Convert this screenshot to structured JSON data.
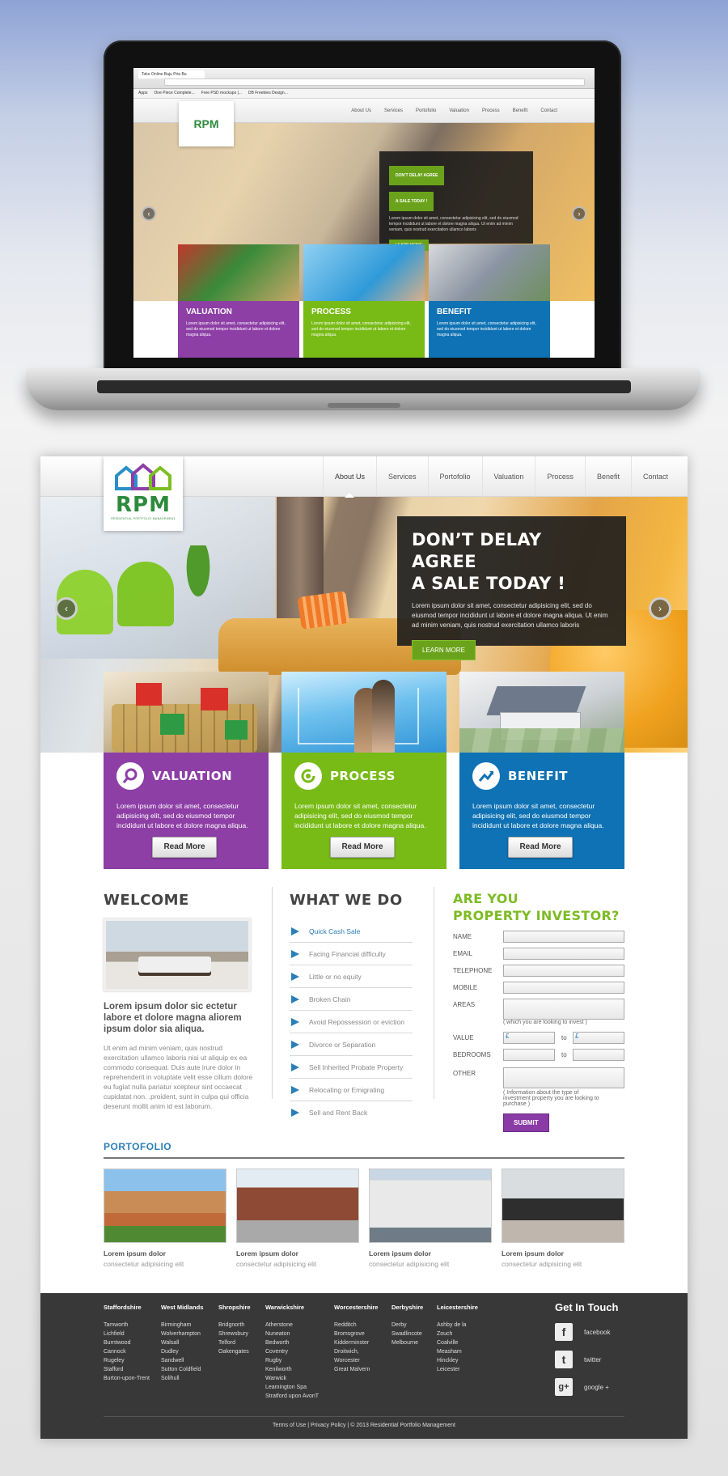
{
  "laptop": {
    "browser_tab": "Toko Online Baju Pria Bu",
    "bookmarks": [
      "Apps",
      "One Piece Complete...",
      "Free PSD mockups |...",
      "DB Freebies Design..."
    ]
  },
  "nav": {
    "links": [
      "About Us",
      "Services",
      "Portofolio",
      "Valuation",
      "Process",
      "Benefit",
      "Contact"
    ],
    "active": "About Us"
  },
  "logo": {
    "text": "RPM",
    "subtitle": "RESIDENTIAL PORTFOLIO MANAGEMENT"
  },
  "hero": {
    "title_line1": "DON’T DELAY AGREE",
    "title_line2": "A SALE TODAY !",
    "text": "Lorem ipsum dolor sit amet, consectetur adipisicing elit, sed do eiusmod tempor incididunt ut labore et dolore magna aliqua. Ut enim ad minim veniam, quis nostrud exercitation ullamco laboris",
    "button": "LEARN MORE",
    "prev_icon": "‹",
    "next_icon": "›"
  },
  "cards": [
    {
      "title": "VALUATION",
      "text": "Lorem ipsum dolor sit amet, consectetur adipisicing elit, sed do eiusmod tempor incididunt ut labore et dolore magna aliqua.",
      "button": "Read More",
      "color": "#8d3fa6"
    },
    {
      "title": "PROCESS",
      "text": "Lorem ipsum dolor sit amet, consectetur adipisicing elit, sed do eiusmod tempor incididunt ut labore et dolore magna aliqua.",
      "button": "Read More",
      "color": "#78bb16"
    },
    {
      "title": "BENEFIT",
      "text": "Lorem ipsum dolor sit amet, consectetur adipisicing elit, sed do eiusmod tempor incididunt ut labore et dolore magna aliqua.",
      "button": "Read More",
      "color": "#0f72b4"
    }
  ],
  "welcome": {
    "title": "WELCOME",
    "lead": "Lorem ipsum dolor sic ectetur labore et dolore magna aliorem ipsum dolor sia aliqua.",
    "text": "Ut enim ad minim veniam, quis nostrud exercitation ullamco laboris nisi ut aliquip ex ea commodo consequat. Duis aute irure dolor in reprehenderit in voluptate velit esse cillum dolore eu fugiat nulla pariatur xcepteur sint occaecat cupidatat non. .proident, sunt in culpa qui officia deserunt mollit anim id est laborum."
  },
  "what_we_do": {
    "title": "WHAT WE DO",
    "items": [
      "Quick Cash Sale",
      "Facing Financial difficulty",
      "Little or no equity",
      "Broken Chain",
      "Avoid Repossession or eviction",
      "Divorce or Separation",
      "Sell Inherited Probate Property",
      "Relocating or Emigrating",
      "Sell and Rent Back"
    ]
  },
  "investor": {
    "title_line1": "ARE YOU",
    "title_line2": "PROPERTY INVESTOR?",
    "fields": [
      "NAME",
      "EMAIL",
      "TELEPHONE",
      "MOBILE",
      "AREAS"
    ],
    "areas_hint": "( which you are looking to invest )",
    "value_label": "VALUE",
    "bedrooms_label": "BEDROOMS",
    "currency": "£",
    "to": "to",
    "other_label": "OTHER",
    "other_hint": "( Information about the type of investment property you are looking to purchase )",
    "submit": "SUBMIT"
  },
  "portfolio": {
    "title": "PORTOFOLIO",
    "items": [
      {
        "name": "Lorem ipsum dolor",
        "sub": "consectetur adipisicing elit"
      },
      {
        "name": "Lorem ipsum dolor",
        "sub": "consectetur adipisicing elit"
      },
      {
        "name": "Lorem ipsum dolor",
        "sub": "consectetur adipisicing elit"
      },
      {
        "name": "Lorem ipsum dolor",
        "sub": "consectetur adipisicing elit"
      }
    ]
  },
  "footer": {
    "columns": [
      {
        "title": "Staffordshire",
        "items": [
          "Tamworth",
          "Lichfield",
          "Burntwood",
          "Cannock",
          "Rugeley",
          "Stafford",
          "Burton-upon-Trent"
        ]
      },
      {
        "title": "West Midlands",
        "items": [
          "Birmingham",
          "Wolverhampton",
          "Walsall",
          "Dudley",
          "Sandwell",
          "Sutton Coldfield",
          "Solihull"
        ]
      },
      {
        "title": "Shropshire",
        "items": [
          "Bridgnorth",
          "Shrewsbury",
          "Telford",
          "Oakengates"
        ]
      },
      {
        "title": "Warwickshire",
        "items": [
          "Atherstone",
          "Nuneaton",
          "Bedworth",
          "Coventry",
          "Rugby",
          "Kenilworth",
          "Warwick",
          "Leamington Spa",
          "Stratford upon AvonT"
        ]
      },
      {
        "title": "Worcestershire",
        "items": [
          "Redditch",
          "Bromsgrove",
          "Kidderminster",
          "Droitwich,",
          "Worcester",
          "Great Malvern"
        ]
      },
      {
        "title": "Derbyshire",
        "items": [
          "Derby",
          "Swadlincote",
          "Melbourne"
        ]
      },
      {
        "title": "Leicestershire",
        "items": [
          "Ashby de la",
          "Zouch",
          "Coalville",
          "Measham",
          "Hinckley",
          "Leicester"
        ]
      }
    ],
    "get_in_touch": "Get In Touch",
    "social": [
      {
        "icon": "f",
        "label": "facebook"
      },
      {
        "icon": "t",
        "label": "twitter"
      },
      {
        "icon": "g+",
        "label": "google +"
      }
    ],
    "copyright": "Terms of Use | Privacy Policy | © 2013 Residential Portfolio Management"
  }
}
